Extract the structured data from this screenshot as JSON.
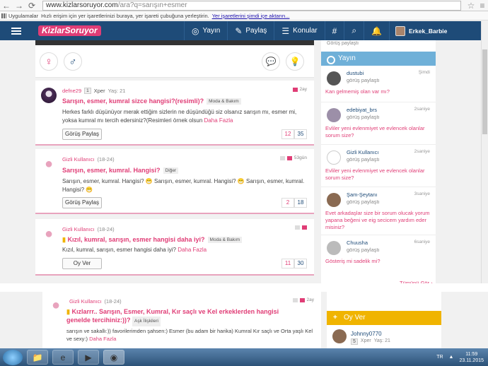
{
  "browser": {
    "url_host": "www.kizlarsoruyor.com",
    "url_path": "/ara?q=sarışın+esmer",
    "bookmarks_apps": "Uygulamalar",
    "bookmarks_hint": "Hızlı erişim için yer işaretlerinizi buraya, yer işareti çubuğuna yerleştirin.",
    "bookmarks_link": "Yer işaretlerini şimdi içe aktarın..."
  },
  "header": {
    "logo": "KizlarSoruyor",
    "nav": [
      {
        "icon": "yayin-icon",
        "label": "Yayın"
      },
      {
        "icon": "paylas-icon",
        "label": "Paylaş"
      },
      {
        "icon": "konular-icon",
        "label": "Konular"
      }
    ],
    "user": "Erkek_Barbie"
  },
  "questions": [
    {
      "user": "defne29",
      "level": "1",
      "xper": "Xper",
      "age": "Yaş: 21",
      "time": "2ay",
      "title": "Sarışın, esmer, kumral sizce hangisi?(resimli)?",
      "category": "Moda & Bakım",
      "body": "Herkes farklı düşünüyor merak ettiğim sizlerin ne düşündüğü siz olsanız sarışın mı, esmer mi, yoksa kumral mı tercih edersiniz?(Resimleri örnek olsun",
      "more": "Daha Fazla",
      "cta": "Görüş Paylaş",
      "count_a": "12",
      "count_b": "35"
    },
    {
      "user": "Gizli Kullanıcı",
      "age": "(18-24)",
      "time": "53gün",
      "title": "Sarışın, esmer, kumral. Hangisi?",
      "category": "Diğer",
      "body": "Sarışın, esmer, kumral. Hangisi? 😁 Sarışın, esmer, kumral. Hangisi? 😁 Sarışın, esmer, kumral. Hangisi? 😁",
      "cta": "Görüş Paylaş",
      "count_a": "2",
      "count_b": "18"
    },
    {
      "user": "Gizli Kullanıcı",
      "age": "(18-24)",
      "time": "",
      "title": "Kızıl, kumral, sarışın, esmer hangisi daha iyi?",
      "category": "Moda & Bakım",
      "body": "Kızıl, kumral, sarışın, esmer hangisi daha iyi?",
      "more": "Daha Fazla",
      "cta": "Oy Ver",
      "count_a": "11",
      "count_b": "30"
    },
    {
      "user": "Gizli Kullanıcı",
      "age": "(18-24)",
      "time": "2ay",
      "title": "Kızlarrr.. Sarışın, Esmer, Kumral, Kır saçlı ve Kel erkeklerden hangisi genelde tercihiniz:))?",
      "category": "Aşk İlişkileri",
      "body": "sarışın ve sakallı:)) favorilerimden şahsen:) Esmer (bu adam bir harika) Kumral Kır saçlı ve Orta yaşlı Kel ve sexy:)",
      "more": "Daha Fazla"
    }
  ],
  "sidebar": {
    "title": "Yayın",
    "top_snippet": "Görüş paylaştı",
    "items": [
      {
        "name": "dustubi",
        "action": "görüş paylaştı",
        "ago": "Şimdi",
        "question": "Kan gelmemiş olan var mı?"
      },
      {
        "name": "edebiyat_brs",
        "action": "görüş paylaştı",
        "ago": "2saniye",
        "question": "Evliler yeni evlenmiyet ve evlencek olanlar sorum size?"
      },
      {
        "name": "Gizli Kullanıcı",
        "action": "görüş paylaştı",
        "ago": "2saniye",
        "question": "Evliler yeni evlenmiyet ve evlencek olanlar sorum size?"
      },
      {
        "name": "Şam-Şeytanı",
        "action": "görüş paylaştı",
        "ago": "3saniye",
        "question": "Evet arkadaşlar size bir sorum olucak yorum yapana beğeni ve eig secicem yardım eder misiniz?"
      },
      {
        "name": "Chuusha",
        "action": "görüş paylaştı",
        "ago": "6saniye",
        "question": "Gösteriş mi sadelik mi?"
      }
    ],
    "all_link": "Tümünü Gör"
  },
  "oyver": {
    "title": "Oy Ver",
    "user": "Johnny0770",
    "level": "5",
    "xper": "Xper",
    "age": "Yaş: 21"
  },
  "taskbar": {
    "lang": "TR",
    "time": "11:59",
    "date": "23.11.2015"
  }
}
